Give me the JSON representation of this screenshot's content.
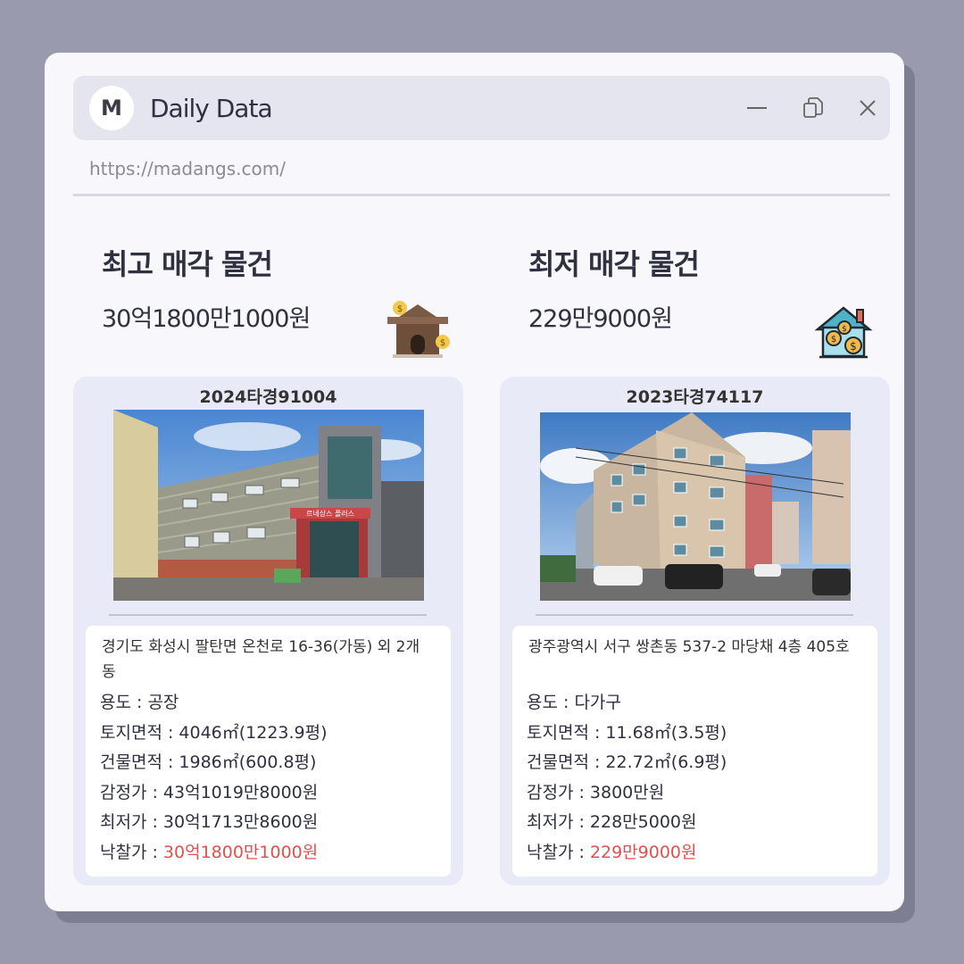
{
  "app": {
    "logo_letter": "M",
    "title": "Daily Data",
    "url": "https://madangs.com/"
  },
  "window_controls": [
    "minimize-icon",
    "restore-icon",
    "close-icon"
  ],
  "highest": {
    "heading": "최고 매각 물건",
    "price": "30억1800만1000원",
    "icon": "house-money-icon",
    "case_no": "2024타경91004",
    "address": "경기도 화성시 팔탄면 온천로 16-36(가동) 외 2개 동",
    "use": "용도 : 공장",
    "land_area": "토지면적 : 4046㎡(1223.9평)",
    "building_area": "건물면적 : 1986㎡(600.8평)",
    "appraisal": "감정가 : 43억1019만8000원",
    "minimum": "최저가 : 30억1713만8600원",
    "winning_label": "낙찰가 : ",
    "winning_value": "30억1800만1000원",
    "photo_sign": "르네상스 플러스"
  },
  "lowest": {
    "heading": "최저 매각 물건",
    "price": "229만9000원",
    "icon": "house-coins-icon",
    "case_no": "2023타경74117",
    "address": "광주광역시 서구 쌍촌동 537-2 마당채 4층 405호",
    "use": "용도 : 다가구",
    "land_area": "토지면적 : 11.68㎡(3.5평)",
    "building_area": "건물면적 : 22.72㎡(6.9평)",
    "appraisal": "감정가 : 3800만원",
    "minimum": "최저가 : 228만5000원",
    "winning_label": "낙찰가 : ",
    "winning_value": "229만9000원"
  },
  "colors": {
    "accent_red": "#e05050",
    "background": "#999aad",
    "card": "#e9eaf8"
  }
}
